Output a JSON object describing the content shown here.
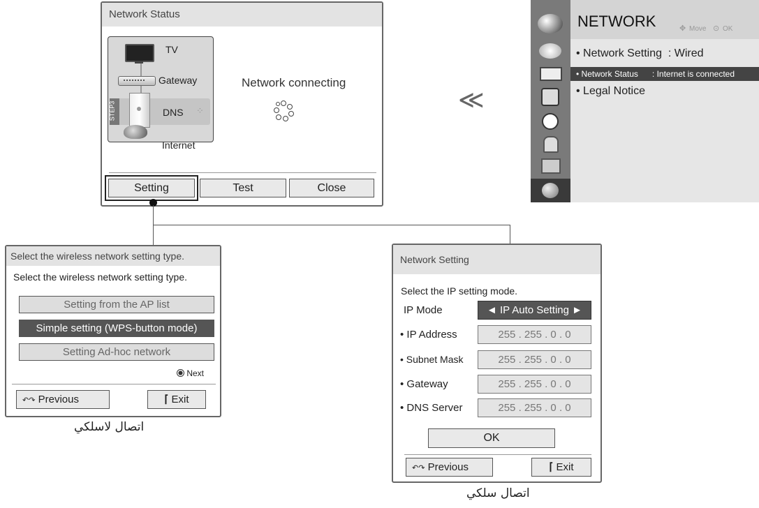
{
  "network_status": {
    "title": "Network Status",
    "devices": [
      "TV",
      "Gateway",
      "DNS",
      "Internet"
    ],
    "step_label": "STEP3",
    "message": "Network connecting",
    "buttons": [
      "Setting",
      "Test",
      "Close"
    ]
  },
  "network_menu": {
    "title": "NETWORK",
    "hint_move": "Move",
    "hint_ok": "OK",
    "items": [
      {
        "label": "• Network Setting",
        "value": ": Wired"
      },
      {
        "label": "• Network Status",
        "value": ": Internet is connected"
      },
      {
        "label": "• Legal Notice",
        "value": ""
      }
    ],
    "side_icons": [
      "globe-icon",
      "picture-icon",
      "screen-icon",
      "audio-icon",
      "clock-icon",
      "lock-icon",
      "option-icon",
      "network-icon"
    ]
  },
  "arrow_symbol": "≪",
  "wireless": {
    "title": "Select the wireless network setting type.",
    "subtitle": "Select the wireless network setting type.",
    "options": [
      "Setting from the AP list",
      "Simple setting (WPS-button mode)",
      "Setting Ad-hoc network"
    ],
    "next": "Next",
    "previous": "Previous",
    "exit": "Exit",
    "caption": "اتصال لاسلكي"
  },
  "wired": {
    "title": "Network Setting",
    "subtitle": "Select the IP setting mode.",
    "ip_mode_label": "IP Mode",
    "ip_mode_value": "◄ IP Auto Setting ►",
    "rows": [
      {
        "label": "• IP Address",
        "value": "255 . 255 . 0 . 0"
      },
      {
        "label": "• Subnet Mask",
        "value": "255 . 255 . 0 . 0"
      },
      {
        "label": "• Gateway",
        "value": "255 . 255 . 0 . 0"
      },
      {
        "label": "• DNS Server",
        "value": "255 . 255 . 0 . 0"
      }
    ],
    "ok": "OK",
    "previous": "Previous",
    "exit": "Exit",
    "caption": "اتصال سلكي"
  }
}
